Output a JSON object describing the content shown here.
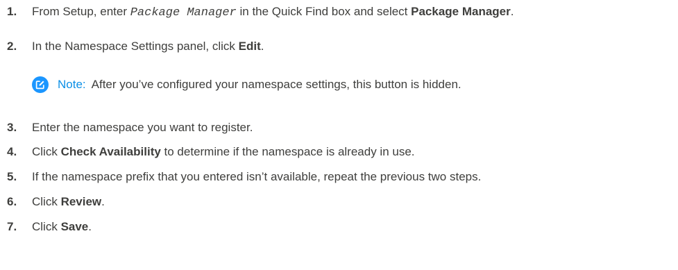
{
  "steps": [
    {
      "number": "1.",
      "segments": [
        {
          "text": "From Setup, enter ",
          "style": "normal"
        },
        {
          "text": "Package Manager",
          "style": "code"
        },
        {
          "text": " in the Quick Find box and select ",
          "style": "normal"
        },
        {
          "text": "Package Manager",
          "style": "bold"
        },
        {
          "text": ".",
          "style": "normal"
        }
      ]
    },
    {
      "number": "2.",
      "segments": [
        {
          "text": "In the Namespace Settings panel, click ",
          "style": "normal"
        },
        {
          "text": "Edit",
          "style": "bold"
        },
        {
          "text": ".",
          "style": "normal"
        }
      ]
    },
    {
      "number": "3.",
      "segments": [
        {
          "text": "Enter the namespace you want to register.",
          "style": "normal"
        }
      ]
    },
    {
      "number": "4.",
      "segments": [
        {
          "text": "Click ",
          "style": "normal"
        },
        {
          "text": "Check Availability",
          "style": "bold"
        },
        {
          "text": " to determine if the namespace is already in use.",
          "style": "normal"
        }
      ]
    },
    {
      "number": "5.",
      "segments": [
        {
          "text": "If the namespace prefix that you entered isn’t available, repeat the previous two steps.",
          "style": "normal"
        }
      ]
    },
    {
      "number": "6.",
      "segments": [
        {
          "text": "Click ",
          "style": "normal"
        },
        {
          "text": "Review",
          "style": "bold"
        },
        {
          "text": ".",
          "style": "normal"
        }
      ]
    },
    {
      "number": "7.",
      "segments": [
        {
          "text": "Click ",
          "style": "normal"
        },
        {
          "text": "Save",
          "style": "bold"
        },
        {
          "text": ".",
          "style": "normal"
        }
      ]
    }
  ],
  "note": {
    "icon": "edit-note-icon",
    "label": "Note:",
    "text": "After you’ve configured your namespace settings, this button is hidden."
  },
  "colors": {
    "text": "#3e3e3c",
    "note_label": "#0b8fe6",
    "note_icon_bg": "#1b96ff"
  }
}
